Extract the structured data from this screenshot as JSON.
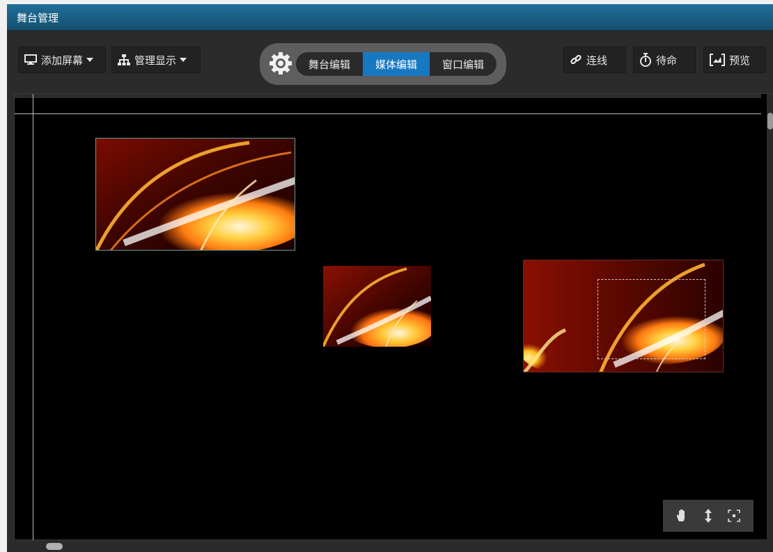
{
  "window": {
    "title": "舞台管理"
  },
  "toolbar": {
    "add_screen": {
      "label": "添加屏幕",
      "icon": "monitor-icon"
    },
    "manage_display": {
      "label": "管理显示",
      "icon": "hierarchy-icon"
    },
    "mode_tabs": [
      {
        "label": "舞台编辑",
        "active": false
      },
      {
        "label": "媒体编辑",
        "active": true
      },
      {
        "label": "窗口编辑",
        "active": false
      }
    ],
    "connect": {
      "label": "连线",
      "icon": "link-icon"
    },
    "standby": {
      "label": "待命",
      "icon": "stopwatch-icon"
    },
    "preview": {
      "label": "预览",
      "icon": "preview-icon"
    }
  },
  "canvas": {
    "media_items": [
      {
        "name": "media-window-1",
        "kind": "image"
      },
      {
        "name": "media-window-2",
        "kind": "image"
      },
      {
        "name": "media-window-3",
        "kind": "image",
        "has_selection": true
      }
    ],
    "view_tools": [
      "hand-icon",
      "move-up-down-icon",
      "fit-to-screen-icon"
    ]
  },
  "colors": {
    "titlebar": "#1a5f86",
    "active_tab": "#1778c2",
    "canvas": "#000000",
    "chrome": "#2b2b2b"
  }
}
